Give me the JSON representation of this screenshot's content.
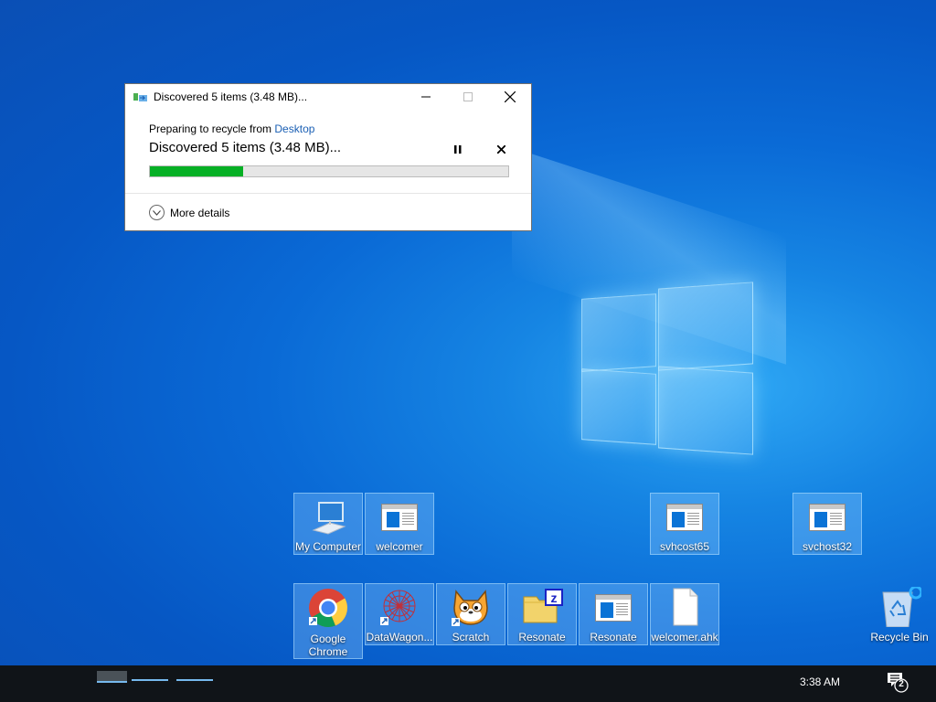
{
  "dialog": {
    "title": "Discovered 5 items (3.48 MB)...",
    "preparing_prefix": "Preparing to recycle from ",
    "preparing_link": "Desktop",
    "status": "Discovered 5 items (3.48 MB)...",
    "progress_fraction": 0.26,
    "progress_color": "#06b025",
    "more_details": "More details",
    "icons": {
      "app": "recycle-progress-icon",
      "minimize": "minimize-icon",
      "maximize": "maximize-icon",
      "close": "close-icon",
      "pause": "pause-icon",
      "cancel": "cancel-icon",
      "expand": "chevron-down-icon"
    }
  },
  "desktop": {
    "icons": [
      {
        "label": "My Computer",
        "icon": "computer-icon"
      },
      {
        "label": "welcomer",
        "icon": "app-window-icon"
      },
      {
        "label": "svhcost65",
        "icon": "app-window-icon"
      },
      {
        "label": "svchost32",
        "icon": "app-window-icon"
      },
      {
        "label": "Google Chrome",
        "icon": "chrome-icon"
      },
      {
        "label": "DataWagon...",
        "icon": "datawagon-icon"
      },
      {
        "label": "Scratch",
        "icon": "scratch-cat-icon"
      },
      {
        "label": "Resonate",
        "icon": "zip-folder-icon"
      },
      {
        "label": "Resonate",
        "icon": "app-window-icon"
      },
      {
        "label": "welcomer.ahk",
        "icon": "file-icon"
      },
      {
        "label": "Recycle Bin",
        "icon": "recycle-bin-icon"
      }
    ]
  },
  "taskbar": {
    "clock": "3:38 AM",
    "notification_count": "2",
    "accent": "#76b9ed"
  }
}
